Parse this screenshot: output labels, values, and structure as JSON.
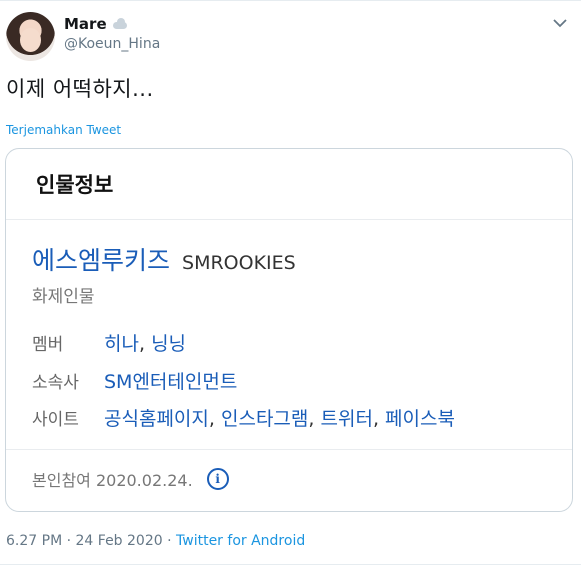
{
  "author": {
    "name": "Mare",
    "name_badge_icon": "cloud-icon",
    "handle": "@Koeun_Hina"
  },
  "tweet": {
    "text": "이제 어떡하지...",
    "translate_label": "Terjemahkan Tweet",
    "menu_icon": "chevron-down-icon"
  },
  "card": {
    "title": "인물정보",
    "entity_name": "에스엠루키즈",
    "entity_name_en": "SMROOKIES",
    "category": "화제인물",
    "rows": [
      {
        "label": "멤버",
        "values": [
          "히나",
          "닝닝"
        ]
      },
      {
        "label": "소속사",
        "values": [
          "SM엔터테인먼트"
        ]
      },
      {
        "label": "사이트",
        "values": [
          "공식홈페이지",
          "인스타그램",
          "트위터",
          "페이스북"
        ]
      }
    ],
    "verified_text": "본인참여 2020.02.24.",
    "info_icon": "info-circle-icon"
  },
  "meta": {
    "time": "6.27 PM",
    "date": "24 Feb 2020",
    "dot": "·",
    "client": "Twitter for Android"
  },
  "colors": {
    "link_blue": "#1a5db8",
    "twitter_blue": "#1b95e0",
    "muted": "#657786"
  }
}
